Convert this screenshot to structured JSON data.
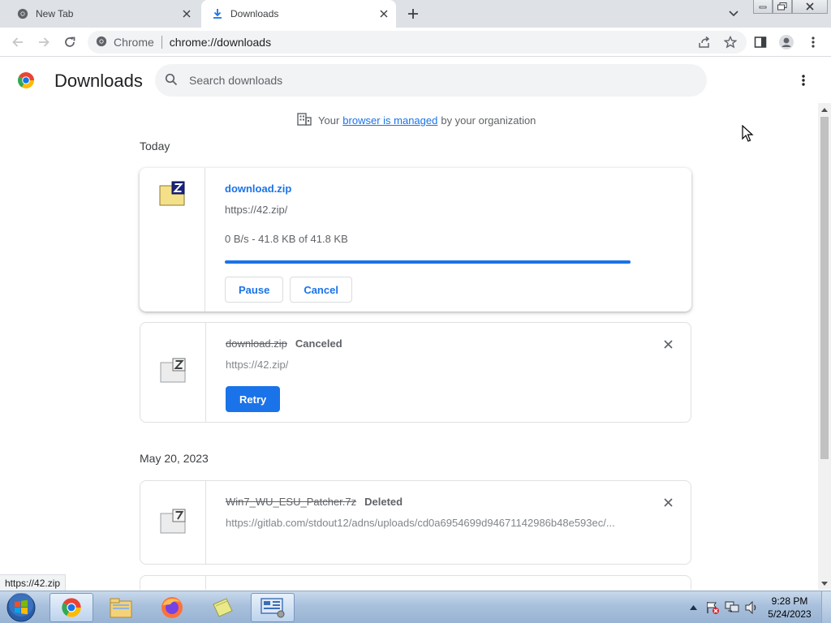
{
  "tabs": [
    {
      "title": "New Tab",
      "icon": "chrome-icon"
    },
    {
      "title": "Downloads",
      "icon": "download-icon",
      "active": true
    }
  ],
  "omnibox": {
    "site_label": "Chrome",
    "url": "chrome://downloads"
  },
  "header": {
    "title": "Downloads",
    "search_placeholder": "Search downloads"
  },
  "managed_notice": {
    "prefix": "Your",
    "link": "browser is managed",
    "suffix": "by your organization"
  },
  "groups": [
    {
      "date": "Today"
    },
    {
      "date": "May 20, 2023"
    }
  ],
  "downloads": [
    {
      "name": "download.zip",
      "url": "https://42.zip/",
      "progress_text": "0 B/s - 41.8 KB of 41.8 KB",
      "progress_fraction": 1.0,
      "pause_label": "Pause",
      "cancel_label": "Cancel"
    },
    {
      "name": "download.zip",
      "state": "Canceled",
      "url": "https://42.zip/",
      "retry_label": "Retry"
    },
    {
      "name": "Win7_WU_ESU_Patcher.7z",
      "state": "Deleted",
      "url": "https://gitlab.com/stdout12/adns/uploads/cd0a6954699d94671142986b48e593ec/..."
    }
  ],
  "status_bubble": "https://42.zip",
  "taskbar": {
    "items": [
      "chrome-icon",
      "explorer-icon",
      "firefox-icon",
      "sticky-notes-icon",
      "control-panel-icon"
    ],
    "time": "9:28 PM",
    "date": "5/24/2023"
  },
  "colors": {
    "accent": "#1a73e8",
    "tabstrip": "#dee1e6"
  }
}
